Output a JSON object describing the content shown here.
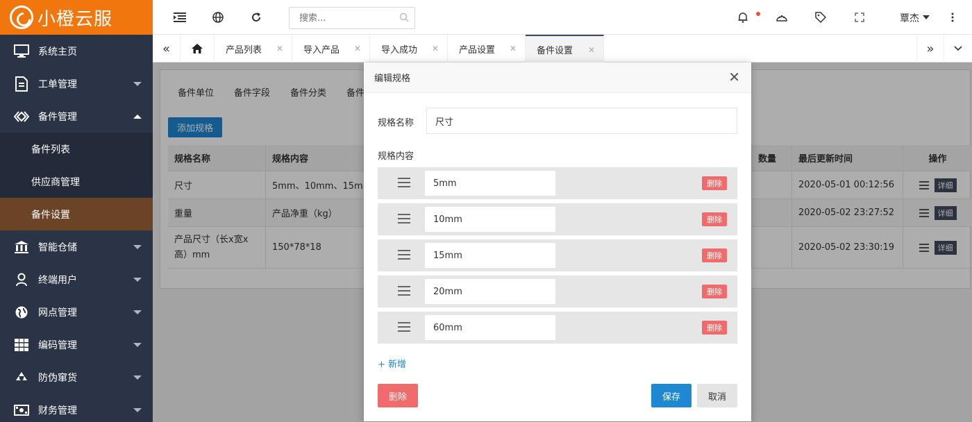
{
  "app": {
    "logo_text": "小橙云服"
  },
  "sidebar": {
    "items": [
      {
        "label": "系统主页",
        "icon": "monitor-icon"
      },
      {
        "label": "工单管理",
        "icon": "document-icon"
      },
      {
        "label": "备件管理",
        "icon": "diamond-icon"
      },
      {
        "label": "智能仓储",
        "icon": "bank-icon"
      },
      {
        "label": "终端用户",
        "icon": "user-icon"
      },
      {
        "label": "网点管理",
        "icon": "globe-icon"
      },
      {
        "label": "编码管理",
        "icon": "grid-icon"
      },
      {
        "label": "防伪窜货",
        "icon": "recycle-icon"
      },
      {
        "label": "财务管理",
        "icon": "money-icon"
      }
    ],
    "sub_items": [
      {
        "label": "备件列表"
      },
      {
        "label": "供应商管理"
      },
      {
        "label": "备件设置"
      }
    ]
  },
  "topbar": {
    "search_placeholder": "搜索...",
    "user_name": "覃杰"
  },
  "tabs": [
    {
      "label": "产品列表"
    },
    {
      "label": "导入产品"
    },
    {
      "label": "导入成功"
    },
    {
      "label": "产品设置"
    },
    {
      "label": "备件设置"
    }
  ],
  "content": {
    "subtabs": [
      "备件单位",
      "备件字段",
      "备件分类",
      "备件"
    ],
    "add_button": "添加规格",
    "table": {
      "headers": [
        "规格名称",
        "规格内容",
        "数量",
        "最后更新时间",
        "操作"
      ],
      "rows": [
        {
          "name": "尺寸",
          "content": "5mm、10mm、15m",
          "updated": "2020-05-01 00:12:56"
        },
        {
          "name": "重量",
          "content": "产品净重（kg）",
          "updated": "2020-05-02 23:27:52"
        },
        {
          "name": "产品尺寸（长x宽x高）mm",
          "content": "150*78*18",
          "updated": "2020-05-02 23:30:19"
        }
      ],
      "detail_label": "详细"
    }
  },
  "modal": {
    "title": "编辑规格",
    "name_label": "规格名称",
    "name_value": "尺寸",
    "content_label": "规格内容",
    "specs": [
      "5mm",
      "10mm",
      "15mm",
      "20mm",
      "60mm"
    ],
    "row_delete_label": "删除",
    "add_link": "+ 新增",
    "delete_button": "删除",
    "save_button": "保存",
    "cancel_button": "取消"
  },
  "colors": {
    "logo_bg": "#f2760e",
    "sidebar_bg": "#2b3447",
    "active_sub_bg": "#6b4327",
    "primary": "#1e88d3",
    "danger": "#f06b6b"
  }
}
